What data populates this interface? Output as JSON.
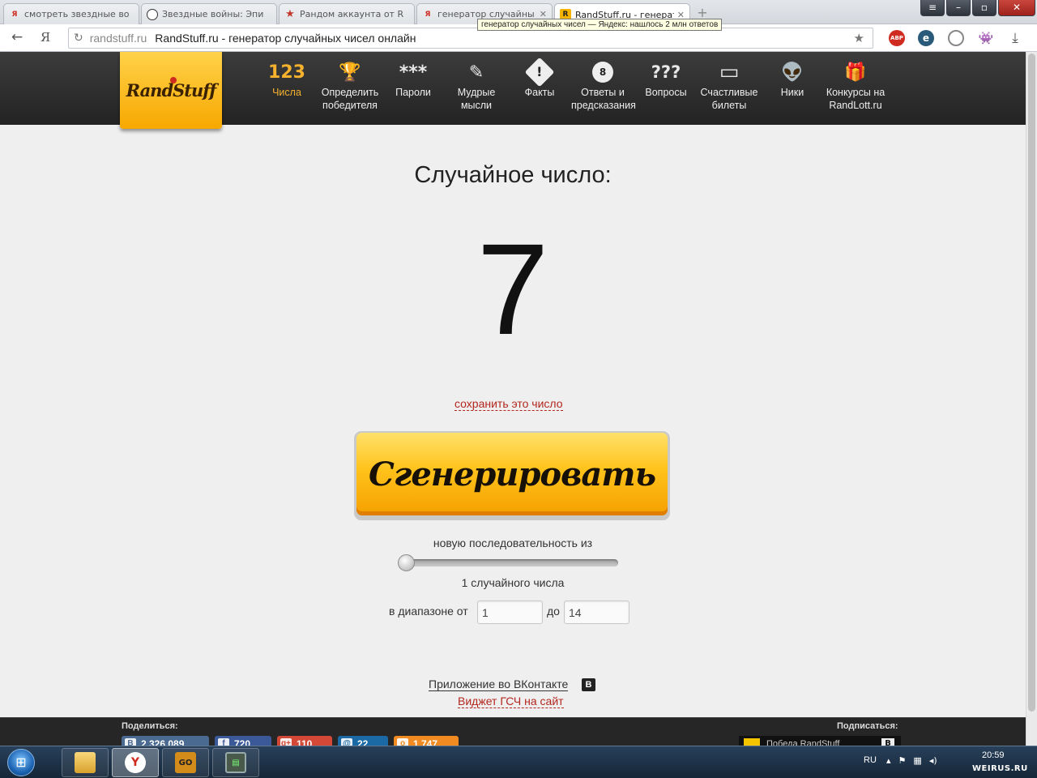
{
  "browser": {
    "tabs": [
      {
        "title": "смотреть звездные во",
        "favicon": "yandex-icon",
        "active": false
      },
      {
        "title": "Звездные войны: Эпи",
        "favicon": "stormtrooper-icon",
        "active": false
      },
      {
        "title": "Рандом аккаунта от R",
        "favicon": "star-icon",
        "active": false
      },
      {
        "title": "генератор случайны",
        "favicon": "yandex-icon",
        "active": false
      },
      {
        "title": "RandStuff.ru - генерат",
        "favicon": "randstuff-icon",
        "active": true
      }
    ],
    "tooltip": "генератор случайных чисел — Яндекс: нашлось 2 млн ответов",
    "address": {
      "domain": "randstuff.ru",
      "title": "RandStuff.ru - генератор случайных чисел онлайн"
    },
    "extensions": {
      "adblock": "ABP"
    }
  },
  "site": {
    "logo": "RandStuff",
    "nav": [
      {
        "icon": "numbers-icon",
        "glyph": "123",
        "label": "Числа",
        "active": true
      },
      {
        "icon": "trophy-icon",
        "glyph": "🏆",
        "label": "Определить победителя",
        "active": false
      },
      {
        "icon": "password-icon",
        "glyph": "***",
        "label": "Пароли",
        "active": false
      },
      {
        "icon": "scroll-icon",
        "glyph": "✎",
        "label": "Мудрые мысли",
        "active": false
      },
      {
        "icon": "warning-icon",
        "glyph": "!",
        "label": "Факты",
        "active": false
      },
      {
        "icon": "eight-ball-icon",
        "glyph": "8",
        "label": "Ответы и предсказания",
        "active": false
      },
      {
        "icon": "question-icon",
        "glyph": "???",
        "label": "Вопросы",
        "active": false
      },
      {
        "icon": "ticket-icon",
        "glyph": "▭",
        "label": "Счастливые билеты",
        "active": false
      },
      {
        "icon": "alien-icon",
        "glyph": "👽",
        "label": "Ники",
        "active": false
      },
      {
        "icon": "gift-icon",
        "glyph": "🎁",
        "label": "Конкурсы на RandLott.ru",
        "active": false
      }
    ]
  },
  "generator": {
    "heading": "Случайное число:",
    "result": "7",
    "save_link": "сохранить это число",
    "button": "Сгенерировать",
    "sequence_label": "новую последовательность из",
    "slider_value": 1,
    "count_label": "1 случайного числа",
    "range_from_label": "в диапазоне от",
    "range_from": "1",
    "range_to_label": "до",
    "range_to": "14",
    "vk_app_link": "Приложение во ВКонтакте",
    "vk_icon": "В",
    "widget_link": "Виджет ГСЧ на сайт"
  },
  "footer": {
    "share_label": "Поделиться:",
    "subscribe_label": "Подписаться:",
    "shares": [
      {
        "network": "vk",
        "count": "2 326 089"
      },
      {
        "network": "facebook",
        "count": "720"
      },
      {
        "network": "google-plus",
        "count": "110"
      },
      {
        "network": "mail-ru",
        "count": "22"
      },
      {
        "network": "odnoklassniki",
        "count": "1 747"
      }
    ],
    "subscribe_text": "Победа RandStuff"
  },
  "taskbar": {
    "language": "RU",
    "time": "20:59",
    "apps": [
      "explorer",
      "yandex-browser",
      "cs-go",
      "task-manager"
    ]
  },
  "watermark": "WEIRUS.RU"
}
